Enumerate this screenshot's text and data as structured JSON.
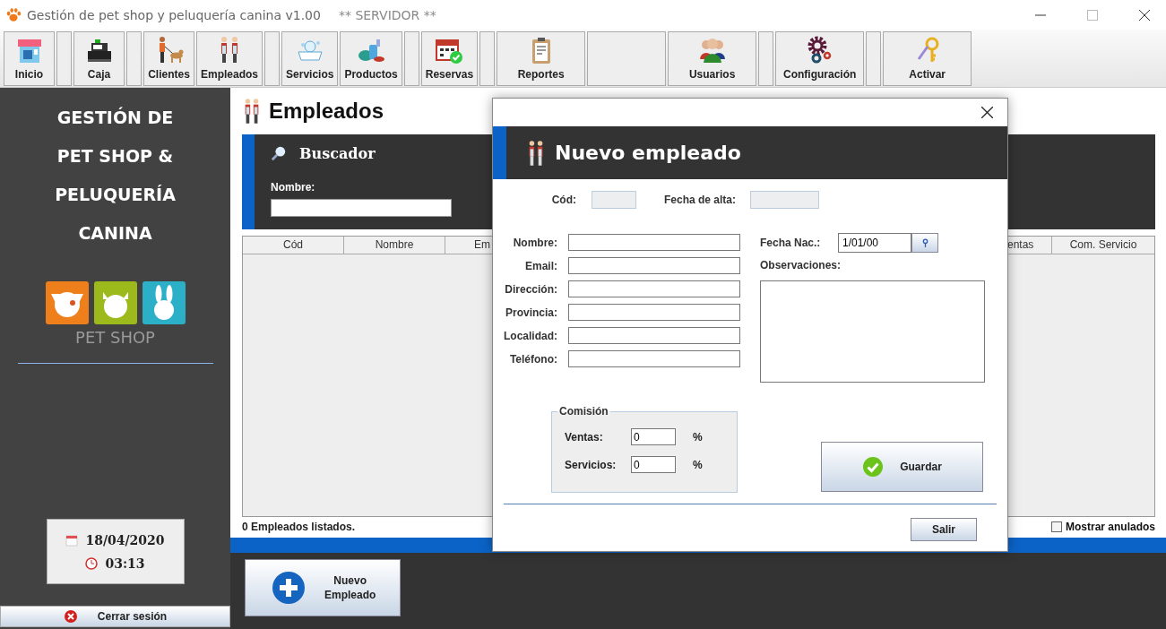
{
  "window": {
    "title": "Gestión de pet shop y peluquería canina v1.00",
    "server_label": "** SERVIDOR **"
  },
  "toolbar": [
    {
      "kind": "button",
      "label": "Inicio"
    },
    {
      "kind": "spacer"
    },
    {
      "kind": "button",
      "label": "Caja"
    },
    {
      "kind": "spacer"
    },
    {
      "kind": "button",
      "label": "Clientes"
    },
    {
      "kind": "button",
      "label": "Empleados"
    },
    {
      "kind": "spacer"
    },
    {
      "kind": "button",
      "label": "Servicios"
    },
    {
      "kind": "button",
      "label": "Productos"
    },
    {
      "kind": "spacer"
    },
    {
      "kind": "button",
      "label": "Reservas"
    },
    {
      "kind": "spacer"
    },
    {
      "kind": "button",
      "label": "Reportes"
    },
    {
      "kind": "blank"
    },
    {
      "kind": "button",
      "label": "Usuarios"
    },
    {
      "kind": "spacer"
    },
    {
      "kind": "button",
      "label": "Configuración"
    },
    {
      "kind": "spacer"
    },
    {
      "kind": "button",
      "label": "Activar"
    }
  ],
  "sidebar": {
    "heading_lines": [
      "GESTIÓN DE",
      "PET SHOP &",
      "PELUQUERÍA",
      "CANINA"
    ],
    "logo_text": "PET SHOP",
    "date": "18/04/2020",
    "time": "03:13",
    "logout": "Cerrar sesión"
  },
  "main": {
    "title": "Empleados",
    "search": {
      "title": "Buscador",
      "label": "Nombre:"
    },
    "table": {
      "columns": [
        "Cód",
        "Nombre",
        "Em",
        "entas",
        "Com. Servicio"
      ]
    },
    "status": "0 Empleados listados.",
    "show_voided": {
      "label": "Mostrar anulados",
      "checked": false
    },
    "new_button": {
      "lines": [
        "Nuevo",
        "Empleado"
      ]
    }
  },
  "dialog": {
    "title": "Nuevo empleado",
    "code_label": "Cód:",
    "date_label": "Fecha de alta:",
    "fields": [
      {
        "label": "Nombre:"
      },
      {
        "label": "Email:"
      },
      {
        "label": "Dirección:"
      },
      {
        "label": "Provincia:"
      },
      {
        "label": "Localidad:"
      },
      {
        "label": "Teléfono:"
      }
    ],
    "birth": {
      "label": "Fecha Nac.:",
      "value": "1/01/00"
    },
    "notes_label": "Observaciones:",
    "commission": {
      "title": "Comisión",
      "rows": [
        {
          "label": "Ventas:",
          "value": "0",
          "unit": "%"
        },
        {
          "label": "Servicios:",
          "value": "0",
          "unit": "%"
        }
      ]
    },
    "save": "Guardar",
    "exit": "Salir"
  }
}
